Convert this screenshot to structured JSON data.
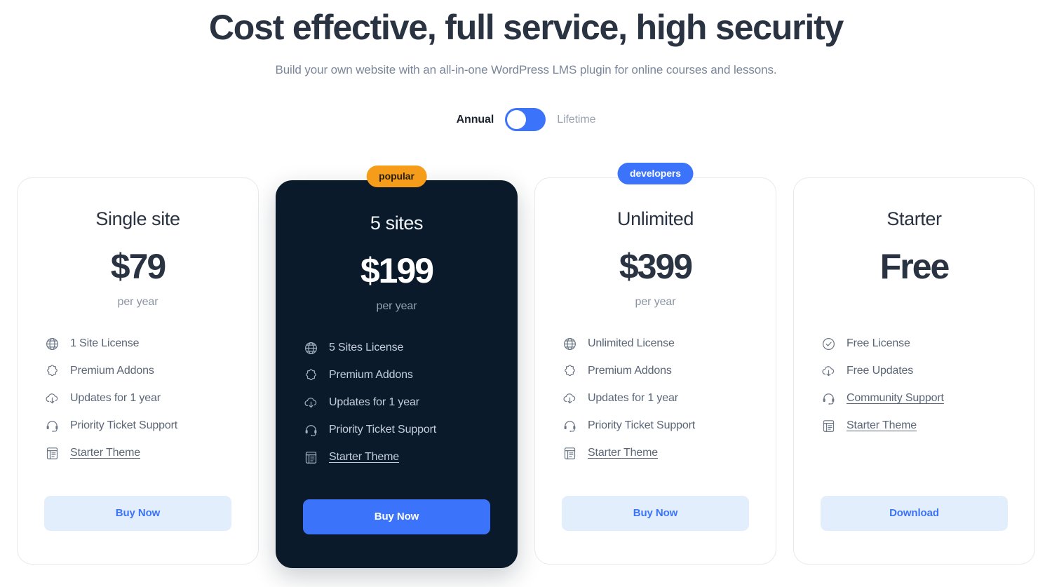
{
  "header": {
    "title": "Cost effective, full service, high security",
    "subtitle": "Build your own website with an all-in-one WordPress LMS plugin for online courses and lessons."
  },
  "billing_toggle": {
    "annual_label": "Annual",
    "lifetime_label": "Lifetime",
    "selected": "Annual",
    "knob_position": "left",
    "track_color": "#3B74FA",
    "knob_color": "#FFFFFF"
  },
  "colors": {
    "accent_blue": "#3B74FA",
    "accent_blue_soft": "#E3EEFC",
    "badge_orange": "#F59C1A",
    "featured_card_bg": "#0B1A2B",
    "heading": "#2A3342",
    "muted_text": "#7A8699",
    "card_border": "#E7E9ED"
  },
  "plans": [
    {
      "id": "single-site",
      "name": "Single site",
      "price": "$79",
      "period": "per year",
      "badge": null,
      "featured": false,
      "features": [
        {
          "icon": "globe-icon",
          "label": "1 Site License",
          "link": false
        },
        {
          "icon": "puzzle-icon",
          "label": "Premium Addons",
          "link": false
        },
        {
          "icon": "cloud-download-icon",
          "label": "Updates for 1 year",
          "link": false
        },
        {
          "icon": "headset-icon",
          "label": "Priority Ticket Support",
          "link": false
        },
        {
          "icon": "theme-document-icon",
          "label": "Starter Theme",
          "link": true
        }
      ],
      "cta": {
        "label": "Buy Now",
        "style": "soft"
      }
    },
    {
      "id": "5-sites",
      "name": "5 sites",
      "price": "$199",
      "period": "per year",
      "badge": {
        "text": "popular",
        "style": "popular"
      },
      "featured": true,
      "features": [
        {
          "icon": "globe-icon",
          "label": "5 Sites License",
          "link": false
        },
        {
          "icon": "puzzle-icon",
          "label": "Premium Addons",
          "link": false
        },
        {
          "icon": "cloud-download-icon",
          "label": "Updates for 1 year",
          "link": false
        },
        {
          "icon": "headset-icon",
          "label": "Priority Ticket Support",
          "link": false
        },
        {
          "icon": "theme-document-icon",
          "label": "Starter Theme",
          "link": true
        }
      ],
      "cta": {
        "label": "Buy Now",
        "style": "primary"
      }
    },
    {
      "id": "unlimited",
      "name": "Unlimited",
      "price": "$399",
      "period": "per year",
      "badge": {
        "text": "developers",
        "style": "developers"
      },
      "featured": false,
      "features": [
        {
          "icon": "globe-icon",
          "label": "Unlimited License",
          "link": false
        },
        {
          "icon": "puzzle-icon",
          "label": "Premium Addons",
          "link": false
        },
        {
          "icon": "cloud-download-icon",
          "label": "Updates for 1 year",
          "link": false
        },
        {
          "icon": "headset-icon",
          "label": "Priority Ticket Support",
          "link": false
        },
        {
          "icon": "theme-document-icon",
          "label": "Starter Theme",
          "link": true
        }
      ],
      "cta": {
        "label": "Buy Now",
        "style": "soft"
      }
    },
    {
      "id": "starter",
      "name": "Starter",
      "price": "Free",
      "period": "",
      "badge": null,
      "featured": false,
      "features": [
        {
          "icon": "check-circle-icon",
          "label": "Free License",
          "link": false
        },
        {
          "icon": "cloud-download-icon",
          "label": "Free Updates",
          "link": false
        },
        {
          "icon": "headset-icon",
          "label": "Community Support",
          "link": true
        },
        {
          "icon": "theme-document-icon",
          "label": "Starter Theme",
          "link": true
        }
      ],
      "cta": {
        "label": "Download",
        "style": "soft"
      }
    }
  ]
}
